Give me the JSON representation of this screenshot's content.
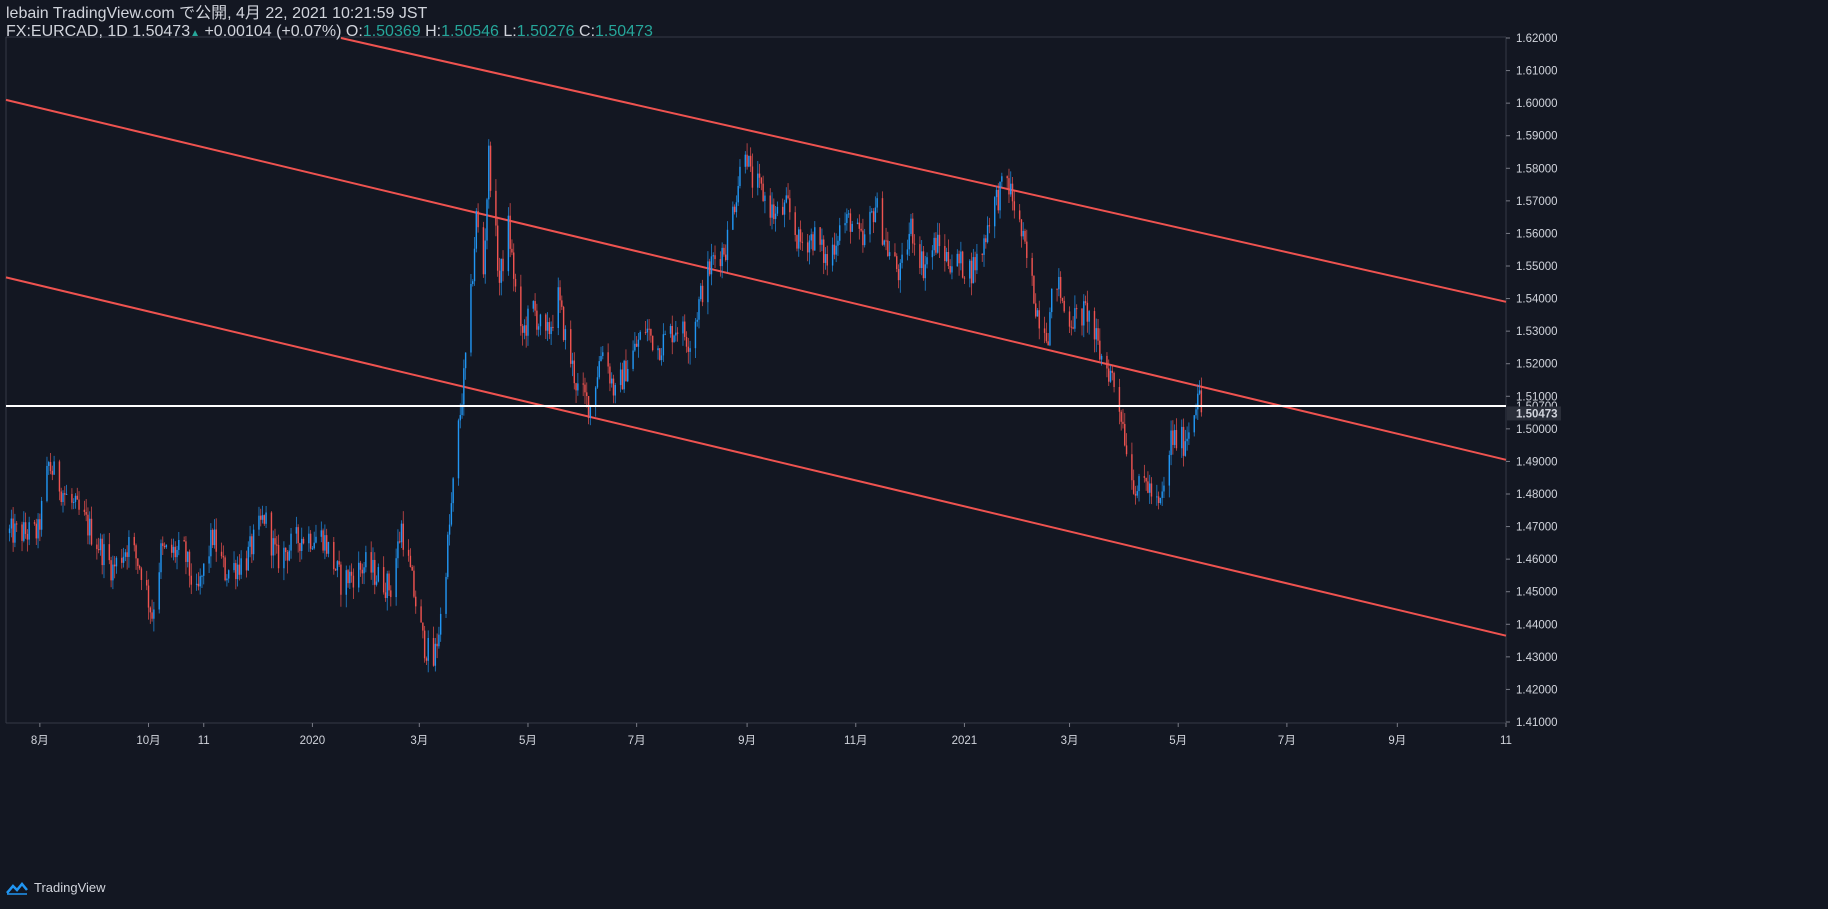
{
  "header": {
    "line1": "lebain TradingView.com で公開, 4月 22, 2021 10:21:59 JST",
    "symbol": "FX:EURCAD, 1D",
    "last": "1.50473",
    "change": "+0.00104 (+0.07%)",
    "o_label": "O:",
    "o_value": "1.50369",
    "h_label": "H:",
    "h_value": "1.50546",
    "l_label": "L:",
    "l_value": "1.50276",
    "c_label": "C:",
    "c_value": "1.50473"
  },
  "footer": {
    "brand": "TradingView"
  },
  "colors": {
    "background": "#131722",
    "up": "#2196f3",
    "down": "#ef5350",
    "trendline": "#ef5350",
    "level": "#ffffff",
    "text": "#d1d4dc",
    "value_green": "#26a69a"
  },
  "chart_data": {
    "type": "candlestick",
    "y_axis": {
      "min": 1.41,
      "max": 1.62,
      "ticks": [
        "1.41000",
        "1.42000",
        "1.43000",
        "1.44000",
        "1.45000",
        "1.46000",
        "1.47000",
        "1.48000",
        "1.49000",
        "1.50000",
        "1.51000",
        "1.52000",
        "1.53000",
        "1.54000",
        "1.55000",
        "1.56000",
        "1.57000",
        "1.58000",
        "1.59000",
        "1.60000",
        "1.61000",
        "1.62000"
      ]
    },
    "x_axis": {
      "labels": [
        "8月",
        "10月",
        "11",
        "2020",
        "3月",
        "5月",
        "7月",
        "9月",
        "11月",
        "2021",
        "3月",
        "5月",
        "7月",
        "9月",
        "11"
      ],
      "dates": [
        "2019-08-01",
        "2019-10-01",
        "2019-11-01",
        "2020-01-01",
        "2020-03-01",
        "2020-05-01",
        "2020-07-01",
        "2020-09-01",
        "2020-11-01",
        "2021-01-01",
        "2021-03-01",
        "2021-05-01",
        "2021-07-01",
        "2021-09-01",
        "2021-11-01"
      ]
    },
    "horizontal_level": {
      "value": 1.507,
      "label": "1.50700"
    },
    "last_price": {
      "value": 1.50473,
      "label": "1.50473"
    },
    "trend_channel": [
      {
        "name": "upper",
        "from": [
          "2020-01-17",
          1.62
        ],
        "to": [
          "2021-11-01",
          1.539
        ]
      },
      {
        "name": "middle",
        "from": [
          "2019-07-13",
          1.601
        ],
        "to": [
          "2021-11-01",
          1.4905
        ]
      },
      {
        "name": "lower",
        "from": [
          "2019-07-13",
          1.5465
        ],
        "to": [
          "2021-11-01",
          1.4365
        ]
      }
    ],
    "close_path": [
      [
        "2019-07-15",
        1.468
      ],
      [
        "2019-07-31",
        1.468
      ],
      [
        "2019-08-06",
        1.489
      ],
      [
        "2019-08-16",
        1.479
      ],
      [
        "2019-08-27",
        1.471
      ],
      [
        "2019-09-11",
        1.457
      ],
      [
        "2019-09-20",
        1.465
      ],
      [
        "2019-09-27",
        1.457
      ],
      [
        "2019-10-03",
        1.443
      ],
      [
        "2019-10-08",
        1.462
      ],
      [
        "2019-10-21",
        1.462
      ],
      [
        "2019-10-28",
        1.448
      ],
      [
        "2019-11-06",
        1.467
      ],
      [
        "2019-11-13",
        1.456
      ],
      [
        "2019-11-25",
        1.46
      ],
      [
        "2019-12-05",
        1.473
      ],
      [
        "2019-12-12",
        1.46
      ],
      [
        "2019-12-26",
        1.467
      ],
      [
        "2020-01-07",
        1.467
      ],
      [
        "2020-01-17",
        1.453
      ],
      [
        "2020-01-31",
        1.458
      ],
      [
        "2020-02-14",
        1.451
      ],
      [
        "2020-02-20",
        1.47
      ],
      [
        "2020-03-03",
        1.435
      ],
      [
        "2020-03-09",
        1.428
      ],
      [
        "2020-03-13",
        1.442
      ],
      [
        "2020-03-18",
        1.47
      ],
      [
        "2020-03-23",
        1.5
      ],
      [
        "2020-03-26",
        1.515
      ],
      [
        "2020-03-30",
        1.54
      ],
      [
        "2020-04-02",
        1.565
      ],
      [
        "2020-04-06",
        1.548
      ],
      [
        "2020-04-09",
        1.584
      ],
      [
        "2020-04-15",
        1.545
      ],
      [
        "2020-04-20",
        1.562
      ],
      [
        "2020-04-27",
        1.528
      ],
      [
        "2020-05-04",
        1.537
      ],
      [
        "2020-05-11",
        1.527
      ],
      [
        "2020-05-18",
        1.54
      ],
      [
        "2020-05-22",
        1.528
      ],
      [
        "2020-05-29",
        1.512
      ],
      [
        "2020-06-05",
        1.507
      ],
      [
        "2020-06-12",
        1.526
      ],
      [
        "2020-06-19",
        1.51
      ],
      [
        "2020-06-26",
        1.52
      ],
      [
        "2020-07-06",
        1.531
      ],
      [
        "2020-07-13",
        1.525
      ],
      [
        "2020-07-24",
        1.532
      ],
      [
        "2020-07-31",
        1.527
      ],
      [
        "2020-08-07",
        1.543
      ],
      [
        "2020-08-13",
        1.552
      ],
      [
        "2020-08-20",
        1.556
      ],
      [
        "2020-08-25",
        1.57
      ],
      [
        "2020-08-31",
        1.588
      ],
      [
        "2020-09-03",
        1.577
      ],
      [
        "2020-09-10",
        1.572
      ],
      [
        "2020-09-17",
        1.565
      ],
      [
        "2020-09-24",
        1.568
      ],
      [
        "2020-09-30",
        1.557
      ],
      [
        "2020-10-09",
        1.559
      ],
      [
        "2020-10-16",
        1.551
      ],
      [
        "2020-10-23",
        1.562
      ],
      [
        "2020-10-29",
        1.564
      ],
      [
        "2020-11-05",
        1.556
      ],
      [
        "2020-11-12",
        1.569
      ],
      [
        "2020-11-19",
        1.555
      ],
      [
        "2020-11-26",
        1.547
      ],
      [
        "2020-12-02",
        1.562
      ],
      [
        "2020-12-09",
        1.55
      ],
      [
        "2020-12-16",
        1.557
      ],
      [
        "2020-12-23",
        1.552
      ],
      [
        "2021-01-05",
        1.549
      ],
      [
        "2021-01-11",
        1.555
      ],
      [
        "2021-01-16",
        1.568
      ],
      [
        "2021-01-25",
        1.576
      ],
      [
        "2021-01-30",
        1.567
      ],
      [
        "2021-02-05",
        1.552
      ],
      [
        "2021-02-11",
        1.536
      ],
      [
        "2021-02-17",
        1.53
      ],
      [
        "2021-02-21",
        1.548
      ],
      [
        "2021-02-27",
        1.534
      ],
      [
        "2021-03-05",
        1.534
      ],
      [
        "2021-03-11",
        1.536
      ],
      [
        "2021-03-18",
        1.523
      ],
      [
        "2021-03-25",
        1.516
      ],
      [
        "2021-03-30",
        1.505
      ],
      [
        "2021-04-05",
        1.485
      ],
      [
        "2021-04-09",
        1.481
      ],
      [
        "2021-04-13",
        1.484
      ],
      [
        "2021-04-20",
        1.475
      ],
      [
        "2021-04-24",
        1.483
      ],
      [
        "2021-04-27",
        1.497
      ],
      [
        "2021-05-04",
        1.496
      ],
      [
        "2021-05-09",
        1.503
      ],
      [
        "2021-05-12",
        1.513
      ],
      [
        "2021-05-14",
        1.505
      ]
    ]
  }
}
